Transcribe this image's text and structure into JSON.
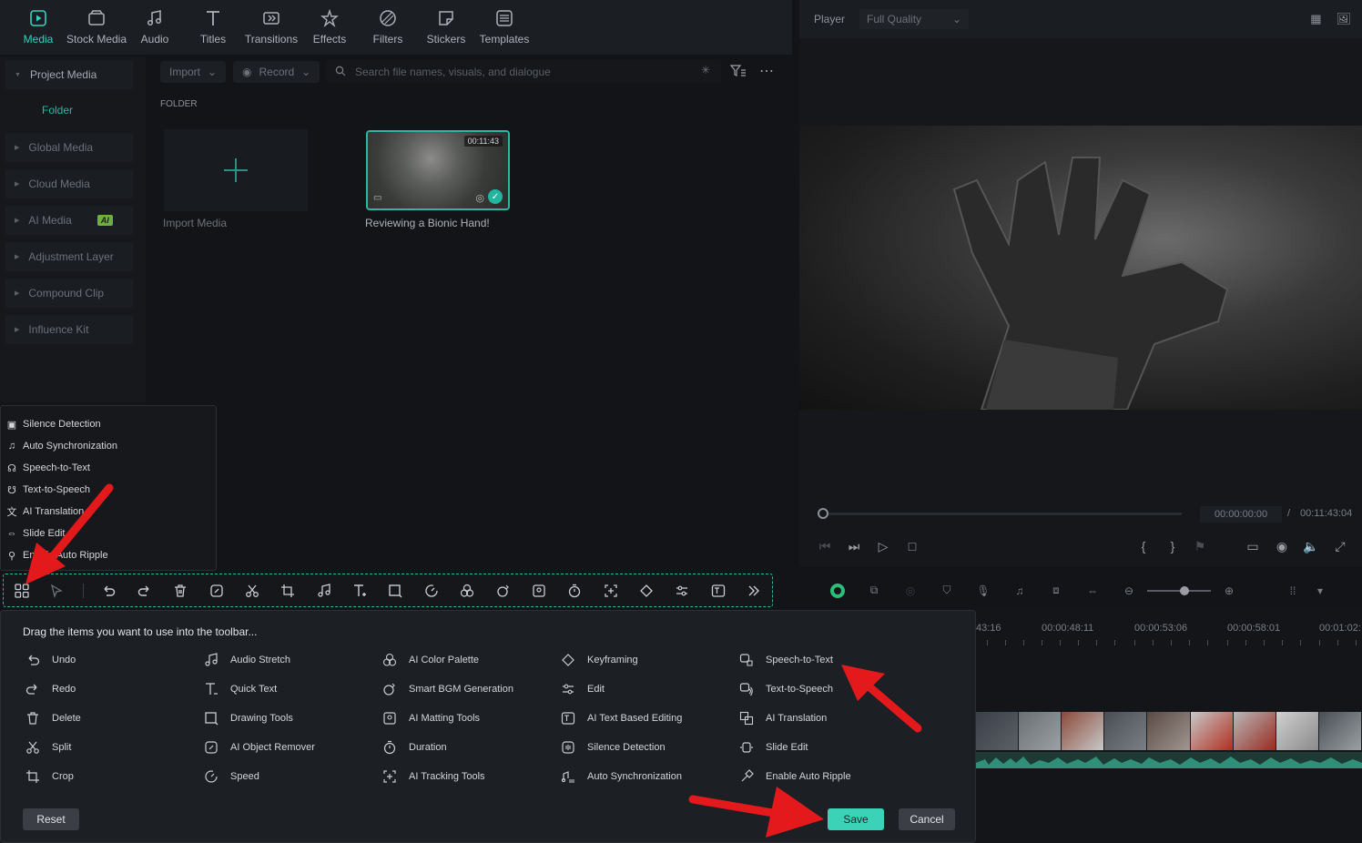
{
  "tabs": [
    {
      "label": "Media",
      "icon": "media-icon",
      "active": true
    },
    {
      "label": "Stock Media",
      "icon": "stock-media-icon"
    },
    {
      "label": "Audio",
      "icon": "audio-icon"
    },
    {
      "label": "Titles",
      "icon": "titles-icon"
    },
    {
      "label": "Transitions",
      "icon": "transitions-icon"
    },
    {
      "label": "Effects",
      "icon": "effects-icon"
    },
    {
      "label": "Filters",
      "icon": "filters-icon"
    },
    {
      "label": "Stickers",
      "icon": "stickers-icon"
    },
    {
      "label": "Templates",
      "icon": "templates-icon"
    }
  ],
  "sidebar": {
    "items": [
      {
        "label": "Project Media"
      },
      {
        "label": "Folder"
      },
      {
        "label": "Global Media"
      },
      {
        "label": "Cloud Media"
      },
      {
        "label": "AI Media",
        "badge": "AI"
      },
      {
        "label": "Adjustment Layer"
      },
      {
        "label": "Compound Clip"
      },
      {
        "label": "Influence Kit"
      }
    ]
  },
  "media": {
    "import_label": "Import",
    "record_label": "Record",
    "search_placeholder": "Search file names, visuals, and dialogue",
    "folder_label": "FOLDER",
    "import_tile_label": "Import Media",
    "clip": {
      "duration": "00:11:43",
      "name": "Reviewing a Bionic Hand!"
    }
  },
  "player": {
    "label": "Player",
    "quality": "Full Quality",
    "current_time": "00:00:00:00",
    "separator": "/",
    "total_time": "00:11:43:04"
  },
  "popup_list": [
    {
      "label": "Silence Detection",
      "icon": "silence-detection-icon"
    },
    {
      "label": "Auto Synchronization",
      "icon": "auto-sync-icon"
    },
    {
      "label": "Speech-to-Text",
      "icon": "speech-to-text-icon"
    },
    {
      "label": "Text-to-Speech",
      "icon": "text-to-speech-icon"
    },
    {
      "label": "AI Translation",
      "icon": "ai-translation-icon"
    },
    {
      "label": "Slide Edit",
      "icon": "slide-edit-icon"
    },
    {
      "label": "Enable Auto Ripple",
      "icon": "auto-ripple-icon"
    }
  ],
  "customize": {
    "title": "Drag the items you want to use into the toolbar...",
    "columns": [
      [
        "Undo",
        "Redo",
        "Delete",
        "Split",
        "Crop"
      ],
      [
        "Audio Stretch",
        "Quick Text",
        "Drawing Tools",
        "AI Object Remover",
        "Speed"
      ],
      [
        "AI Color Palette",
        "Smart BGM Generation",
        "AI Matting Tools",
        "Duration",
        "AI Tracking Tools"
      ],
      [
        "Keyframing",
        "Edit",
        "AI Text Based Editing",
        "Silence Detection",
        "Auto Synchronization"
      ],
      [
        "Speech-to-Text",
        "Text-to-Speech",
        "AI Translation",
        "Slide Edit",
        "Enable Auto Ripple"
      ]
    ],
    "reset_label": "Reset",
    "save_label": "Save",
    "cancel_label": "Cancel"
  },
  "timeline": {
    "ruler": [
      "43:16",
      "00:00:48:11",
      "00:00:53:06",
      "00:00:58:01",
      "00:01:02:"
    ]
  },
  "colors": {
    "accent": "#34d1bf",
    "save": "#3bd2b8",
    "annotation_arrow": "#e3191c"
  }
}
